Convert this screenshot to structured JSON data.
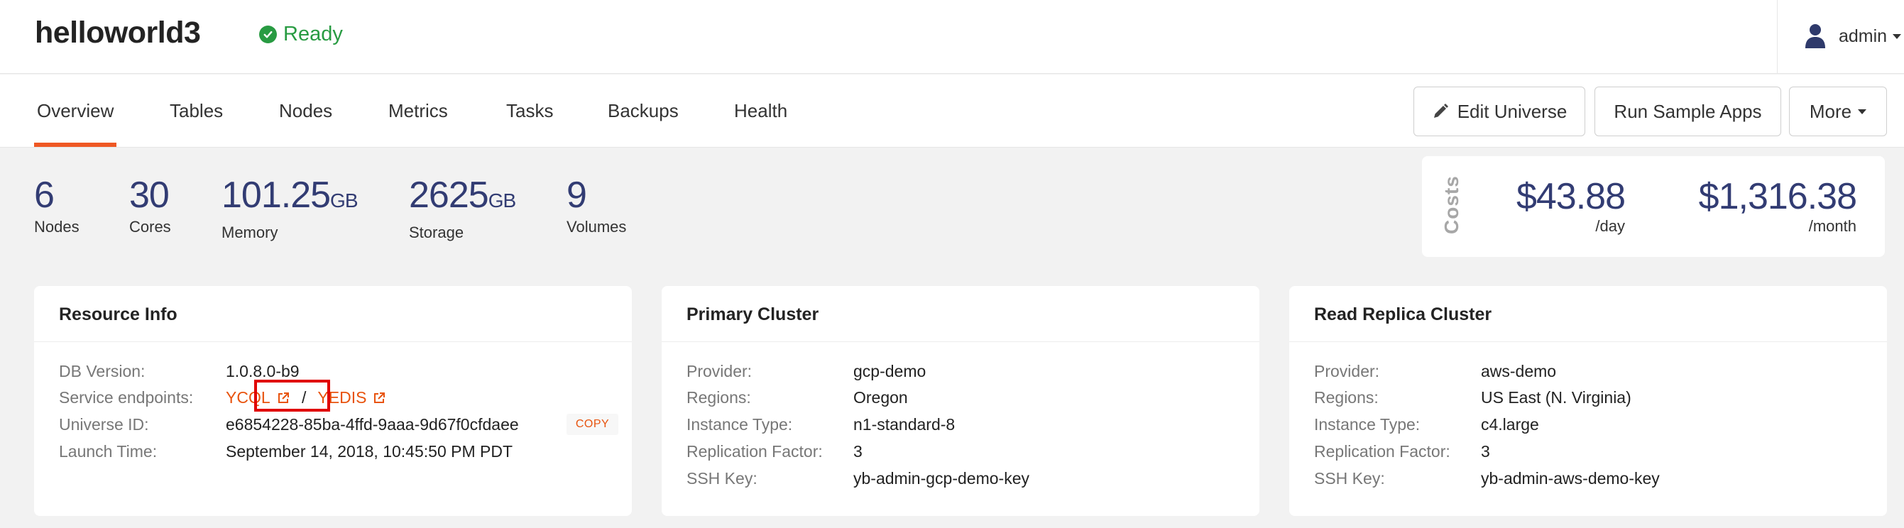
{
  "header": {
    "title": "helloworld3",
    "status": "Ready",
    "user": "admin"
  },
  "tabs": [
    "Overview",
    "Tables",
    "Nodes",
    "Metrics",
    "Tasks",
    "Backups",
    "Health"
  ],
  "actions": {
    "edit": "Edit Universe",
    "run": "Run Sample Apps",
    "more": "More"
  },
  "stats": {
    "nodes": {
      "value": "6",
      "label": "Nodes"
    },
    "cores": {
      "value": "30",
      "label": "Cores"
    },
    "memory": {
      "value": "101.25",
      "unit": "GB",
      "label": "Memory"
    },
    "storage": {
      "value": "2625",
      "unit": "GB",
      "label": "Storage"
    },
    "volumes": {
      "value": "9",
      "label": "Volumes"
    }
  },
  "costs": {
    "label": "Costs",
    "day": {
      "amount": "$43.88",
      "per": "/day"
    },
    "month": {
      "amount": "$1,316.38",
      "per": "/month"
    }
  },
  "resource": {
    "title": "Resource Info",
    "db_version_label": "DB Version:",
    "db_version": "1.0.8.0-b9",
    "endpoints_label": "Service endpoints:",
    "ycql": "YCQL",
    "slash": "/",
    "yedis": "YEDIS",
    "universe_id_label": "Universe ID:",
    "universe_id": "e6854228-85ba-4ffd-9aaa-9d67f0cfdaee",
    "copy": "COPY",
    "launch_label": "Launch Time:",
    "launch": "September 14, 2018, 10:45:50 PM PDT"
  },
  "primary": {
    "title": "Primary Cluster",
    "provider_label": "Provider:",
    "provider": "gcp-demo",
    "regions_label": "Regions:",
    "regions": "Oregon",
    "instance_label": "Instance Type:",
    "instance": "n1-standard-8",
    "rf_label": "Replication Factor:",
    "rf": "3",
    "ssh_label": "SSH Key:",
    "ssh": "yb-admin-gcp-demo-key"
  },
  "replica": {
    "title": "Read Replica Cluster",
    "provider_label": "Provider:",
    "provider": "aws-demo",
    "regions_label": "Regions:",
    "regions": "US East (N. Virginia)",
    "instance_label": "Instance Type:",
    "instance": "c4.large",
    "rf_label": "Replication Factor:",
    "rf": "3",
    "ssh_label": "SSH Key:",
    "ssh": "yb-admin-aws-demo-key"
  },
  "colors": {
    "accent": "#ef5824",
    "ready": "#289b42",
    "stat_blue": "#323c73",
    "highlight": "#e00000"
  }
}
